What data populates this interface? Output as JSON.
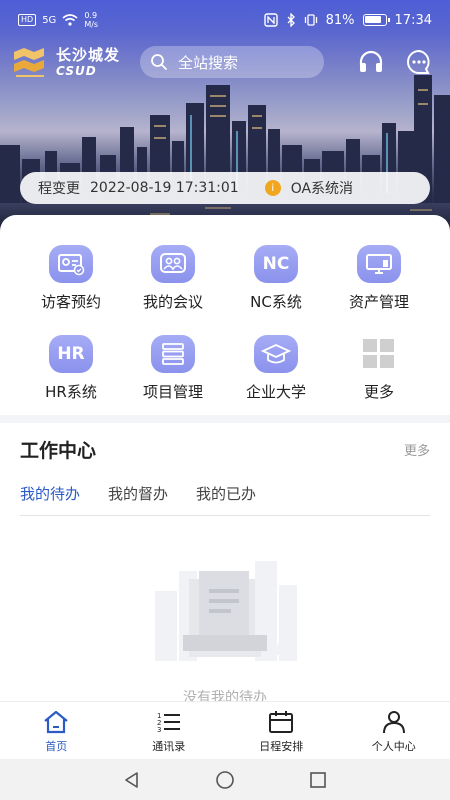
{
  "status_bar": {
    "hd": "HD",
    "signal": "5G",
    "speed_value": "0.9",
    "speed_unit": "M/s",
    "battery_percent": "81%",
    "time": "17:34"
  },
  "header": {
    "logo_cn": "长沙城发",
    "logo_en": "CSUD",
    "search_placeholder": "全站搜索",
    "icons": [
      "headset-icon",
      "chat-icon"
    ]
  },
  "notice": {
    "text_left": "程变更",
    "datetime": "2022-08-19 17:31:01",
    "text_right": "OA系统消",
    "badge": "i",
    "badge_color": "#f0a61f"
  },
  "apps": [
    {
      "label": "访客预约",
      "icon": "visitor-card-icon",
      "glyph": ""
    },
    {
      "label": "我的会议",
      "icon": "meeting-icon",
      "glyph": ""
    },
    {
      "label": "NC系统",
      "icon": "nc-icon",
      "glyph": "NC"
    },
    {
      "label": "资产管理",
      "icon": "monitor-icon",
      "glyph": ""
    },
    {
      "label": "HR系统",
      "icon": "hr-icon",
      "glyph": "HR"
    },
    {
      "label": "项目管理",
      "icon": "server-list-icon",
      "glyph": ""
    },
    {
      "label": "企业大学",
      "icon": "graduation-cap-icon",
      "glyph": ""
    },
    {
      "label": "更多",
      "icon": "grid-more-icon",
      "glyph": ""
    }
  ],
  "work_center": {
    "title": "工作中心",
    "more": "更多",
    "tabs": [
      {
        "label": "我的待办",
        "active": true
      },
      {
        "label": "我的督办",
        "active": false
      },
      {
        "label": "我的已办",
        "active": false
      }
    ],
    "empty_text": "没有我的待办"
  },
  "bottom_nav": [
    {
      "label": "首页",
      "icon": "home-icon",
      "active": true
    },
    {
      "label": "通讯录",
      "icon": "contacts-list-icon",
      "active": false
    },
    {
      "label": "日程安排",
      "icon": "calendar-icon",
      "active": false
    },
    {
      "label": "个人中心",
      "icon": "person-icon",
      "active": false
    }
  ],
  "colors": {
    "accent": "#2b5bc4",
    "app_icon": "#9aa0f0",
    "header_blue": "#4d5ed6"
  }
}
